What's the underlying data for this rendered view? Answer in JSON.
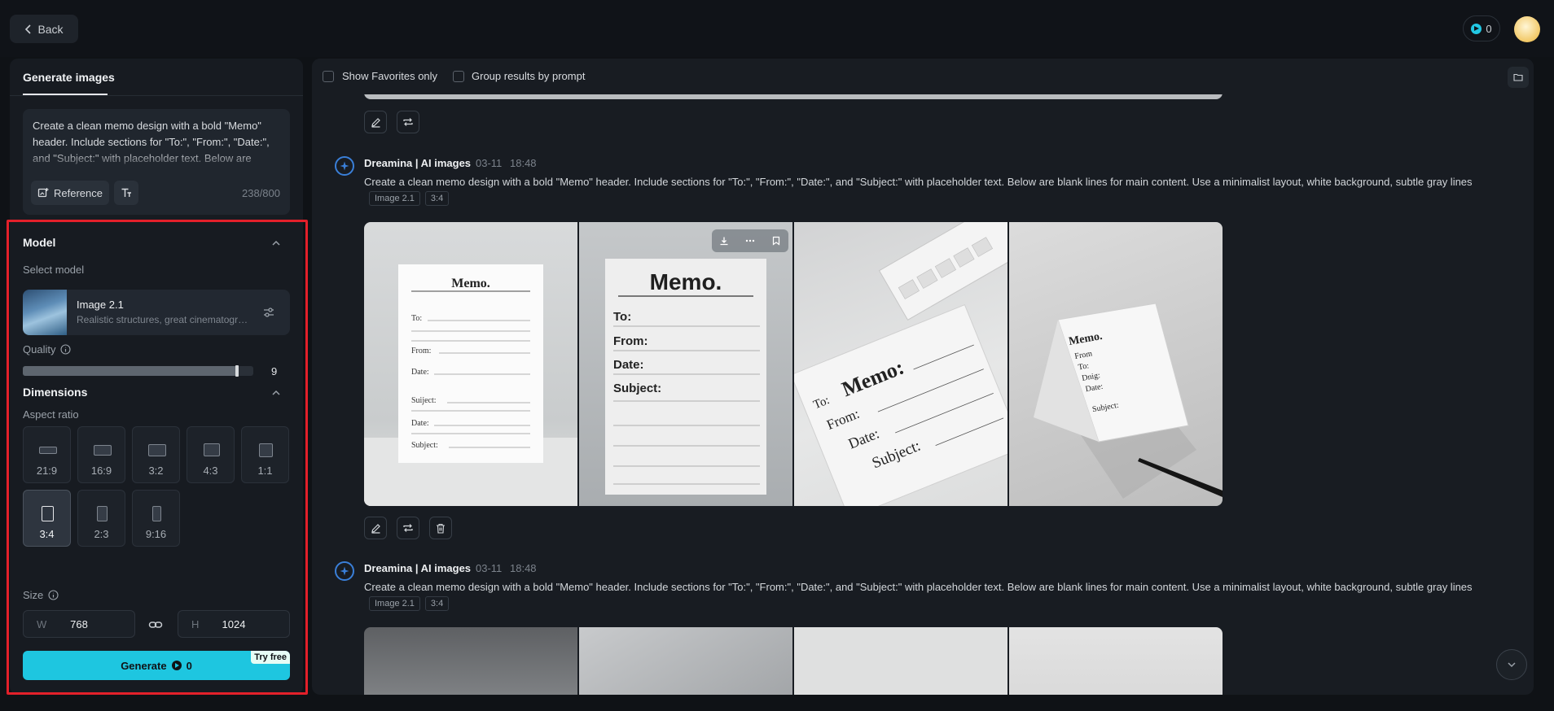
{
  "header": {
    "back_label": "Back",
    "credits": "0"
  },
  "left_panel": {
    "tab": "Generate images",
    "prompt": "Create a clean memo design with a bold \"Memo\" header. Include sections for \"To:\", \"From:\", \"Date:\", and \"Subject:\" with placeholder text. Below are blank lines for main content. Use a minimalist layout, white background, subtle gray lines",
    "reference_label": "Reference",
    "char_count": "238/800",
    "model_title": "Model",
    "select_model_label": "Select model",
    "model_name": "Image 2.1",
    "model_desc": "Realistic structures, great cinematography",
    "quality_label": "Quality",
    "quality_value": "9",
    "quality_fraction": 0.93,
    "dimensions_title": "Dimensions",
    "aspect_label": "Aspect ratio",
    "ratios": [
      "21:9",
      "16:9",
      "3:2",
      "4:3",
      "1:1",
      "3:4",
      "2:3",
      "9:16"
    ],
    "selected_ratio": "3:4",
    "size_label": "Size",
    "width_key": "W",
    "width": "768",
    "height_key": "H",
    "height": "1024",
    "generate_label": "Generate",
    "generate_cost": "0",
    "try_free": "Try free"
  },
  "main": {
    "show_favorites": "Show Favorites only",
    "group_by_prompt": "Group results by prompt",
    "generations": [
      {
        "brand": "Dreamina | AI images",
        "date": "03-11",
        "time": "18:48",
        "prompt_text": "Create a clean memo design with a bold \"Memo\" header. Include sections for \"To:\", \"From:\", \"Date:\", and \"Subject:\" with placeholder text. Below are blank lines for main content. Use a minimalist layout, white background, subtle gray lines",
        "tags": [
          "Image 2.1",
          "3:4"
        ],
        "images": [
          {
            "title": "Memo.",
            "fields": [
              "To:",
              "From:",
              "Date:",
              "Suiject:",
              "Date:",
              "Subject:"
            ]
          },
          {
            "title": "Memo.",
            "fields": [
              "To:",
              "From:",
              "Date:",
              "Subject:"
            ]
          },
          {
            "title": "Memo:",
            "fields": [
              "To:",
              "From:",
              "Date:",
              "Subject:"
            ]
          },
          {
            "title": "Memo.",
            "fields": [
              "From",
              "To:",
              "Dnig:",
              "Date:",
              "Subject:"
            ]
          }
        ]
      },
      {
        "brand": "Dreamina | AI images",
        "date": "03-11",
        "time": "18:48",
        "prompt_text": "Create a clean memo design with a bold \"Memo\" header. Include sections for \"To:\", \"From:\", \"Date:\", and \"Subject:\" with placeholder text. Below are blank lines for main content. Use a minimalist layout, white background, subtle gray lines",
        "tags": [
          "Image 2.1",
          "3:4"
        ]
      }
    ]
  },
  "colors": {
    "accent": "#1ec6e0",
    "highlight": "#e3202a",
    "brand_blue": "#3a7fd8"
  }
}
